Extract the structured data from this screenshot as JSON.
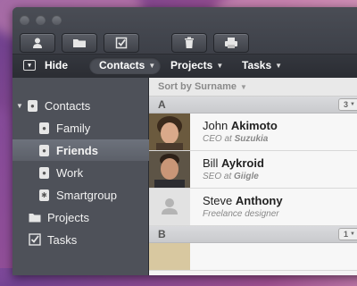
{
  "toolbar": {
    "buttons": [
      {
        "icon": "person-icon"
      },
      {
        "icon": "folder-icon"
      },
      {
        "icon": "checkbox-icon"
      },
      {
        "icon": "trash-icon"
      },
      {
        "icon": "printer-icon"
      }
    ]
  },
  "navbar": {
    "hide_label": "Hide",
    "tabs": [
      {
        "label": "Contacts"
      },
      {
        "label": "Projects"
      },
      {
        "label": "Tasks"
      }
    ]
  },
  "sidebar": {
    "contacts_label": "Contacts",
    "items": [
      {
        "label": "Family"
      },
      {
        "label": "Friends"
      },
      {
        "label": "Work"
      },
      {
        "label": "Smartgroup"
      }
    ],
    "projects_label": "Projects",
    "tasks_label": "Tasks"
  },
  "content": {
    "sort_label": "Sort by Surname",
    "sections": [
      {
        "letter": "A",
        "count": "3"
      },
      {
        "letter": "B",
        "count": "1"
      }
    ],
    "contacts": [
      {
        "first": "John",
        "last": "Akimoto",
        "role": "CEO at",
        "company": "Suzukia"
      },
      {
        "first": "Bill",
        "last": "Aykroid",
        "role": "SEO at",
        "company": "Giigle"
      },
      {
        "first": "Steve",
        "last": "Anthony",
        "subtitle": "Freelance designer"
      }
    ]
  },
  "colors": {
    "sidebar_bg": "#4e5159",
    "selected_row": "#636770",
    "content_bg": "#f4f4f4"
  }
}
